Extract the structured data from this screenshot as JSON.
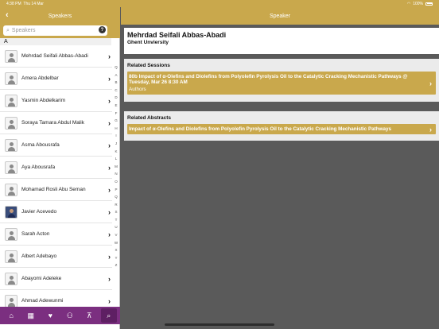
{
  "status": {
    "time": "4:38 PM",
    "date": "Thu 14 Mar",
    "battery": "100%"
  },
  "left": {
    "title": "Speakers",
    "search_placeholder": "Speakers",
    "help": "?",
    "section": "A",
    "speakers": [
      {
        "name": "Mehrdad Seifali Abbas-Abadi",
        "photo": false
      },
      {
        "name": "Amera Abdelbar",
        "photo": false
      },
      {
        "name": "Yasmin Abdelkarim",
        "photo": false
      },
      {
        "name": "Soraya Tamara Abdul Malik",
        "photo": false
      },
      {
        "name": "Asma Abousrafa",
        "photo": false
      },
      {
        "name": "Aya Abousrafa",
        "photo": false
      },
      {
        "name": "Mohamad Rosli Abu Seman",
        "photo": false
      },
      {
        "name": "Javier Acevedo",
        "photo": true
      },
      {
        "name": "Sarah Acton",
        "photo": false
      },
      {
        "name": "Albert Adebayo",
        "photo": false
      },
      {
        "name": "Abayomi Adeleke",
        "photo": false
      },
      {
        "name": "Ahmad Adewunmi",
        "photo": false
      }
    ],
    "index": [
      "Q",
      "A",
      "B",
      "C",
      "D",
      "E",
      "F",
      "G",
      "H",
      "I",
      "J",
      "K",
      "L",
      "M",
      "N",
      "O",
      "P",
      "Q",
      "R",
      "S",
      "T",
      "U",
      "V",
      "W",
      "X",
      "Y",
      "Z"
    ]
  },
  "right": {
    "title": "Speaker",
    "speaker_name": "Mehrdad Seifali Abbas-Abadi",
    "affiliation": "Ghent Unviersity",
    "sessions_heading": "Related Sessions",
    "session_title": "80b Impact of α-Olefins and Diolefins from Polyolefin Pyrolysis Oil to the Catalytic Cracking Mechanistic Pathways @ Tuesday, Mar 26 8:30 AM",
    "session_role": "Authors",
    "abstracts_heading": "Related Abstracts",
    "abstract_title": "Impact of α-Olefins and Diolefins from Polyolefin Pyrolysis Oil to the Catalytic Cracking Mechanistic Pathways"
  },
  "tabs": [
    {
      "icon": "home-icon",
      "glyph": "⌂"
    },
    {
      "icon": "calendar-icon",
      "glyph": "▦"
    },
    {
      "icon": "heart-icon",
      "glyph": "♥"
    },
    {
      "icon": "people-icon",
      "glyph": "⚇"
    },
    {
      "icon": "sitemap-icon",
      "glyph": "⊼"
    },
    {
      "icon": "search-icon",
      "glyph": "⌕"
    }
  ],
  "colors": {
    "gold": "#c9a84c",
    "purple": "#7b2f80",
    "panel_bg": "#5a5a5a"
  }
}
